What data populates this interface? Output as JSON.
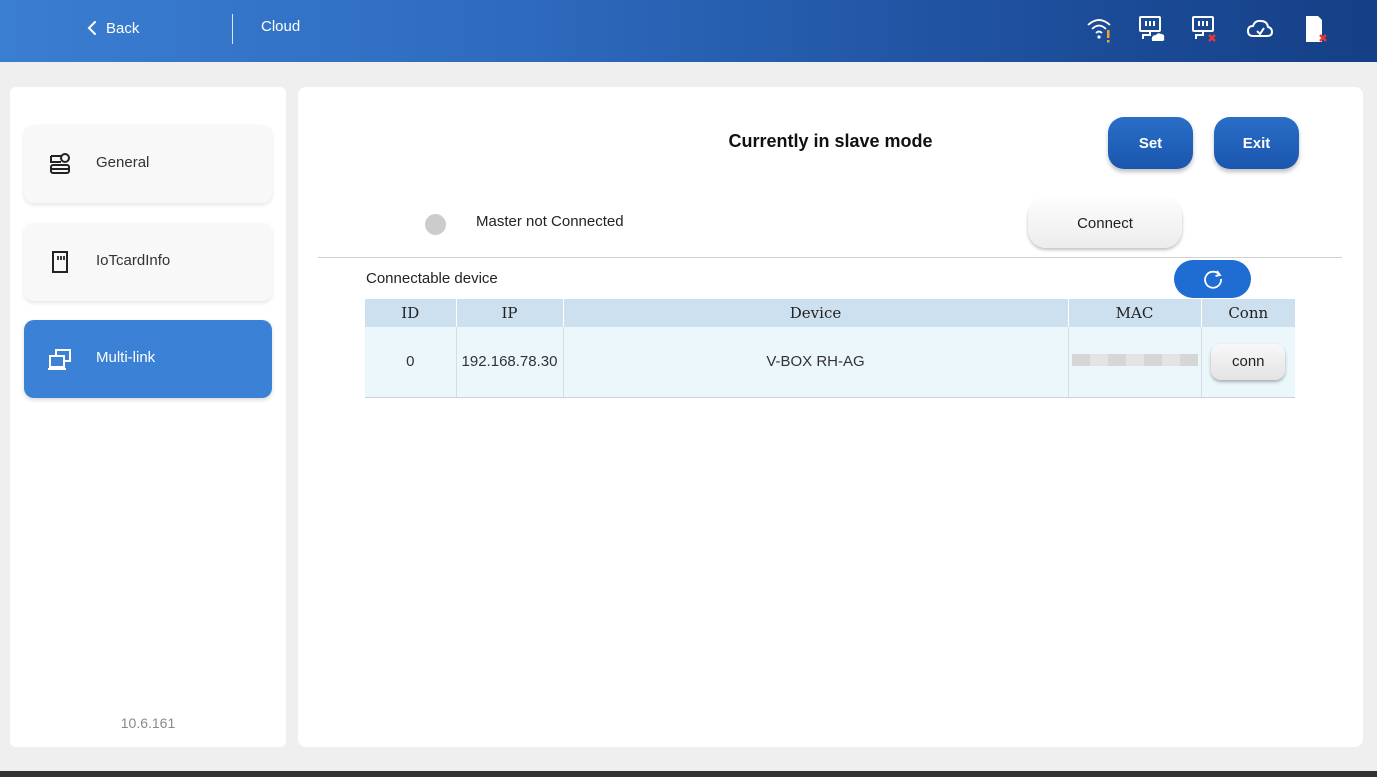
{
  "header": {
    "back_label": "Back",
    "title": "Cloud",
    "status_icons": [
      "wifi-warning-icon",
      "network-cloud-icon",
      "network-error-icon",
      "cloud-icon",
      "sd-card-error-icon"
    ]
  },
  "sidebar": {
    "items": [
      {
        "label": "General",
        "icon": "general-settings-icon",
        "active": false
      },
      {
        "label": "IoTcardInfo",
        "icon": "sim-card-icon",
        "active": false
      },
      {
        "label": "Multi-link",
        "icon": "multi-link-icon",
        "active": true
      }
    ],
    "version": "10.6.161"
  },
  "main": {
    "mode_title": "Currently in slave mode",
    "set_label": "Set",
    "exit_label": "Exit",
    "master_status": "Master not Connected",
    "connect_label": "Connect",
    "connectable_title": "Connectable device",
    "table": {
      "headers": [
        "ID",
        "IP",
        "Device",
        "MAC",
        "Conn"
      ],
      "rows": [
        {
          "id": "0",
          "ip": "192.168.78.30",
          "device": "V-BOX RH-AG",
          "mac": "",
          "conn_label": "conn"
        }
      ]
    }
  },
  "colors": {
    "accent": "#3b82d6",
    "header_start": "#3a7ed1",
    "header_end": "#153f86",
    "button_blue": "#1a56ae",
    "table_header": "#cde0f0",
    "table_row": "#ebf7fb",
    "warning": "#f5a623",
    "error": "#e53935"
  }
}
